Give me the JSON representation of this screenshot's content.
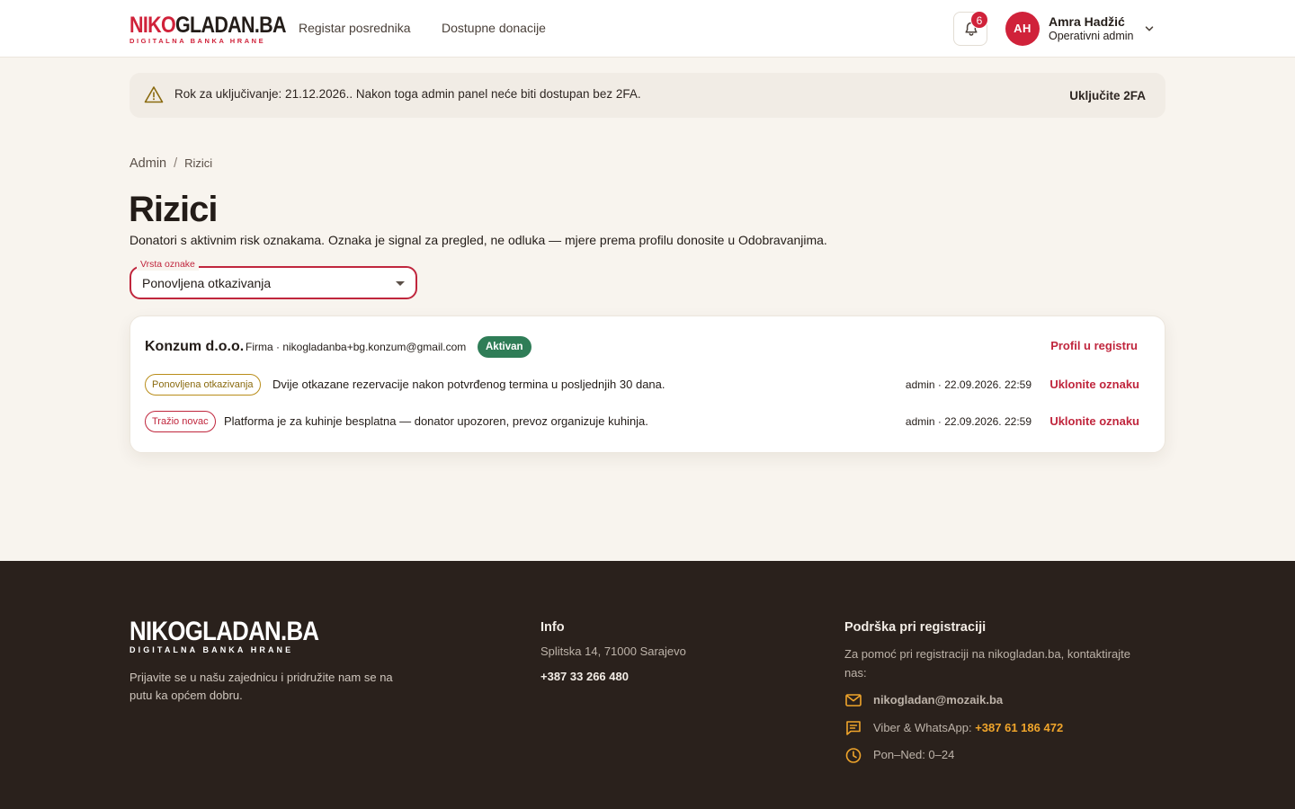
{
  "colors": {
    "brand_red": "#d0223a",
    "accent_red": "#c0263d",
    "success_green": "#2f7d57",
    "footer_bg": "#2a211c",
    "footer_link_orange": "#f0a52b"
  },
  "header": {
    "logo_part1": "NIKO",
    "logo_part2": "GLADAN.BA",
    "logo_sub": "DIGITALNA BANKA HRANE",
    "nav": [
      "Registar posrednika",
      "Dostupne donacije"
    ],
    "notification_count": "6",
    "user": {
      "initials": "AH",
      "name": "Amra Hadžić",
      "role": "Operativni admin"
    }
  },
  "alert": {
    "icon": "warning-triangle-icon",
    "text": "Rok za uključivanje: 21.12.2026.. Nakon toga admin panel neće biti dostupan bez 2FA.",
    "action": "Uključite 2FA"
  },
  "breadcrumb": {
    "root": "Admin",
    "separator": "/",
    "current": "Rizici"
  },
  "page": {
    "title": "Rizici",
    "description": "Donatori s aktivnim risk oznakama. Oznaka je signal za pregled, ne odluka — mjere prema profilu donosite u Odobravanjima."
  },
  "filter": {
    "label": "Vrsta oznake",
    "value": "Ponovljena otkazivanja"
  },
  "donors": [
    {
      "name": "Konzum d.o.o.",
      "meta": "Firma · nikogladanba+bg.konzum@gmail.com",
      "status": "Aktivan",
      "profile_link": "Profil u registru",
      "flags": [
        {
          "chip": "Ponovljena otkazivanja",
          "text": "Dvije otkazane rezervacije nakon potvrđenog termina u posljednjih 30 dana.",
          "meta": "admin · 22.09.2026. 22:59",
          "action": "Uklonite oznaku"
        },
        {
          "chip": "Tražio novac",
          "text": "Platforma je za kuhinje besplatna — donator upozoren, prevoz organizuje kuhinja.",
          "meta": "admin · 22.09.2026. 22:59",
          "action": "Uklonite oznaku"
        }
      ]
    }
  ],
  "footer": {
    "logo_main": "NIKOGLADAN.BA",
    "logo_sub": "DIGITALNA BANKA HRANE",
    "tagline": "Prijavite se u našu zajednicu i pridružite nam se na putu ka općem dobru.",
    "info": {
      "heading": "Info",
      "address": "Splitska 14, 71000 Sarajevo",
      "phone": "+387 33 266 480"
    },
    "support": {
      "heading": "Podrška pri registraciji",
      "description": "Za pomoć pri registraciji na nikogladan.ba, kontaktirajte nas:",
      "email": "nikogladan@mozaik.ba",
      "messaging_label": "Viber & WhatsApp: ",
      "messaging_number": "+387 61 186 472",
      "hours": "Pon–Ned: 0–24"
    }
  }
}
